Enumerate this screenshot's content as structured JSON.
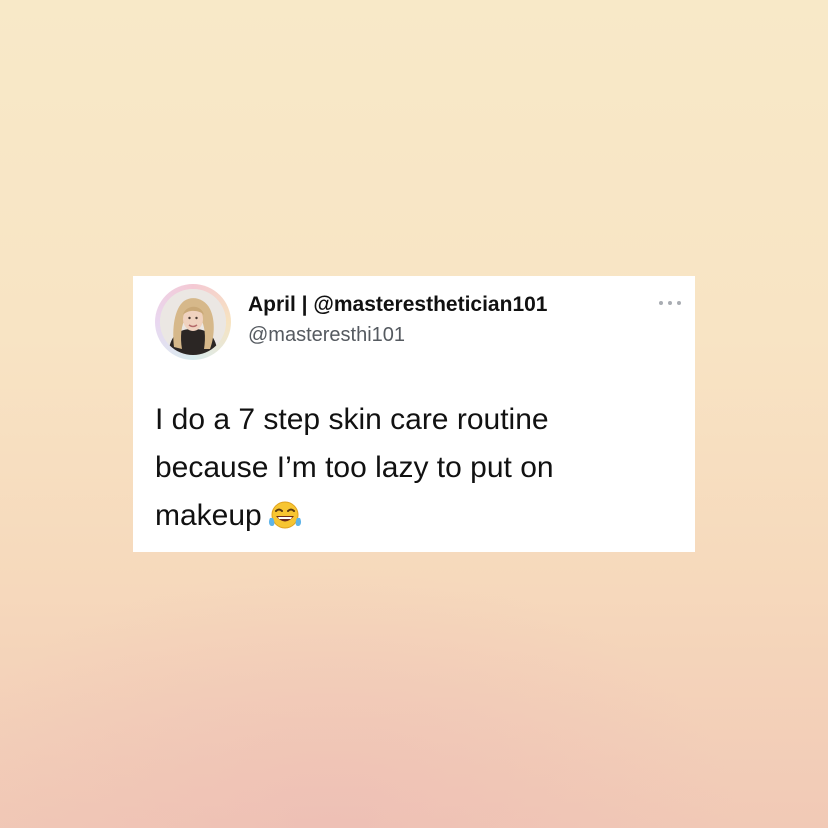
{
  "tweet": {
    "display_name": "April | @masteresthetician101",
    "handle": "@masteresthi101",
    "text_lines": [
      "I do a 7 step skin care routine",
      "because I’m too lazy to put on",
      "makeup"
    ],
    "emoji": "face-with-tears-of-joy"
  },
  "icons": {
    "more": "more-options-icon",
    "avatar": "profile-photo"
  },
  "colors": {
    "background_top": "#f8e9c8",
    "background_bottom": "#f1c9b6",
    "card": "#ffffff",
    "text": "#111111",
    "handle_text": "#555a60"
  }
}
